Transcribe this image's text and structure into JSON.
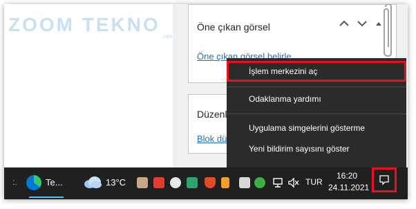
{
  "watermark": {
    "text": "ZOOM TEKNO",
    "sub": ".com"
  },
  "featured_panel": {
    "title": "Öne çıkan görsel",
    "link": "Öne çıkan görsel belirle"
  },
  "edit_panel": {
    "title": "Düzenle",
    "link": "Blok düzenleyici"
  },
  "context_menu": {
    "items": [
      {
        "label": "İşlem merkezini aç",
        "highlighted": true
      },
      {
        "label": "Odaklanma yardımı"
      },
      {
        "label": "Uygulama simgelerini gösterme"
      },
      {
        "label": "Yeni bildirim sayısını göster"
      }
    ]
  },
  "taskbar": {
    "app_label": "Te...",
    "weather": "13°C",
    "language": "TUR",
    "time": "16:20",
    "date": "24.11.2021"
  },
  "colors": {
    "highlight_red": "#e81123",
    "menu_bg": "#2b2b2b",
    "taskbar_bg": "#202020",
    "link_blue": "#2271b1"
  }
}
